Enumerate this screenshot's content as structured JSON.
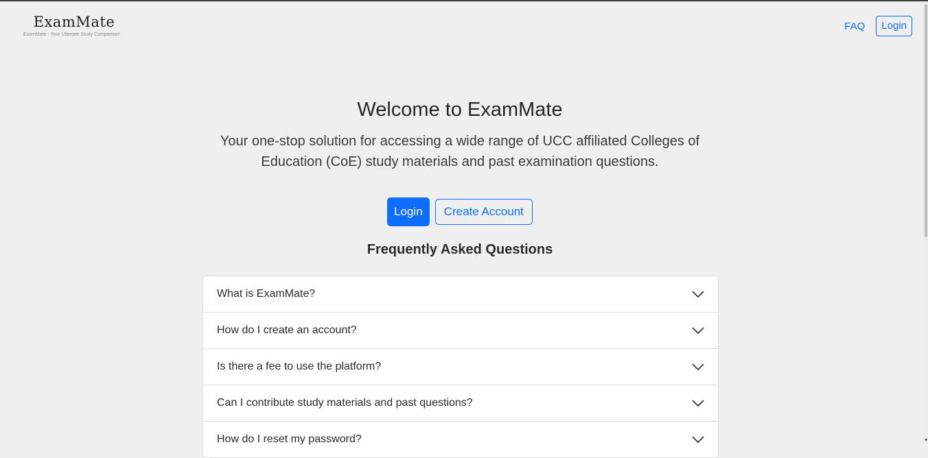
{
  "brand": {
    "name": "ExamMate",
    "tagline": "ExamMate - Your Ultimate Study Companion!"
  },
  "nav": {
    "faq": "FAQ",
    "login": "Login"
  },
  "hero": {
    "title": "Welcome to ExamMate",
    "subtitle": "Your one-stop solution for accessing a wide range of UCC affiliated Colleges of Education (CoE) study materials and past examination questions."
  },
  "cta": {
    "login": "Login",
    "create_account": "Create Account"
  },
  "faq": {
    "title": "Frequently Asked Questions",
    "items": [
      {
        "question": "What is ExamMate?"
      },
      {
        "question": "How do I create an account?"
      },
      {
        "question": "Is there a fee to use the platform?"
      },
      {
        "question": "Can I contribute study materials and past questions?"
      },
      {
        "question": "How do I reset my password?"
      }
    ]
  },
  "icons": {
    "accordion_toggle": "chevron-down-icon"
  },
  "colors": {
    "accent": "#0d6efd",
    "background": "#efefef"
  }
}
